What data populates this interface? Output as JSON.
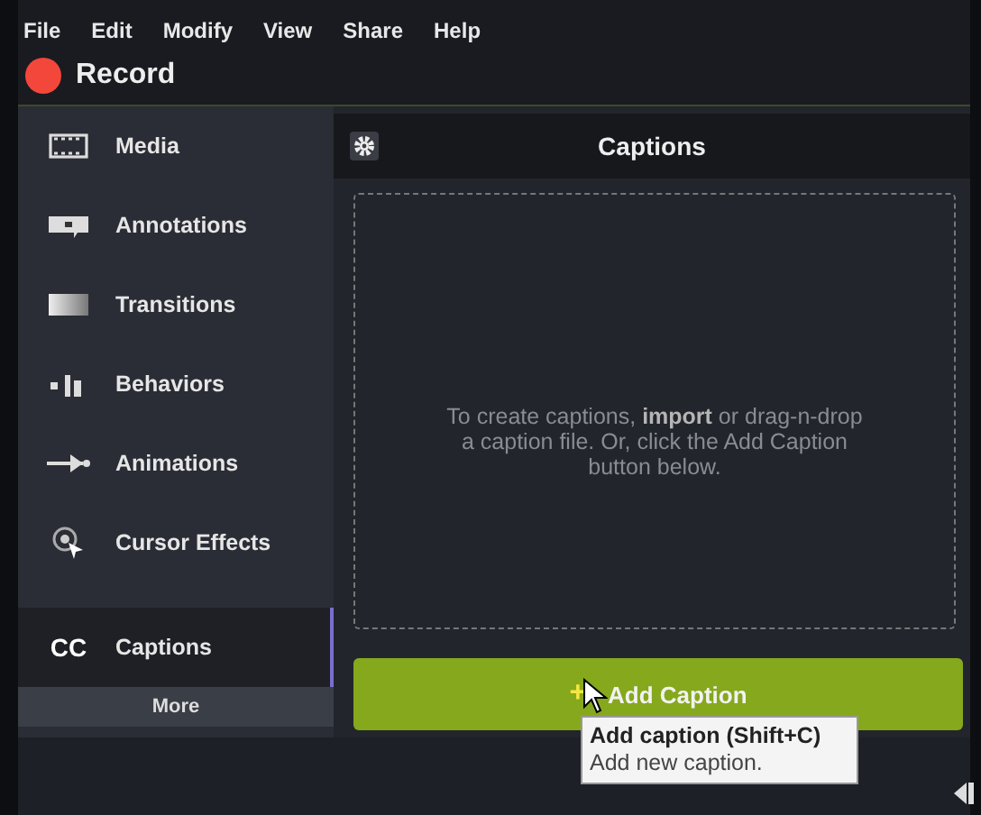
{
  "menu": [
    "File",
    "Edit",
    "Modify",
    "View",
    "Share",
    "Help"
  ],
  "record": {
    "label": "Record"
  },
  "sidebar": {
    "items": [
      {
        "label": "Media",
        "kind": "media",
        "selected": false
      },
      {
        "label": "Annotations",
        "kind": "annotations",
        "selected": false
      },
      {
        "label": "Transitions",
        "kind": "transitions",
        "selected": false
      },
      {
        "label": "Behaviors",
        "kind": "behaviors",
        "selected": false
      },
      {
        "label": "Animations",
        "kind": "animations",
        "selected": false
      },
      {
        "label": "Cursor Effects",
        "kind": "cursor",
        "selected": false
      },
      {
        "label": "Captions",
        "kind": "captions",
        "icon_text": "CC",
        "selected": true
      }
    ],
    "more": "More"
  },
  "panel": {
    "title": "Captions",
    "hint": "To create captions, **import** or drag-n-drop a caption file. Or, click the Add Caption button below.",
    "button": {
      "icon": "+",
      "label": "Add Caption"
    },
    "tooltip": {
      "title": "Add caption (Shift+C)",
      "text": "Add new caption."
    }
  }
}
